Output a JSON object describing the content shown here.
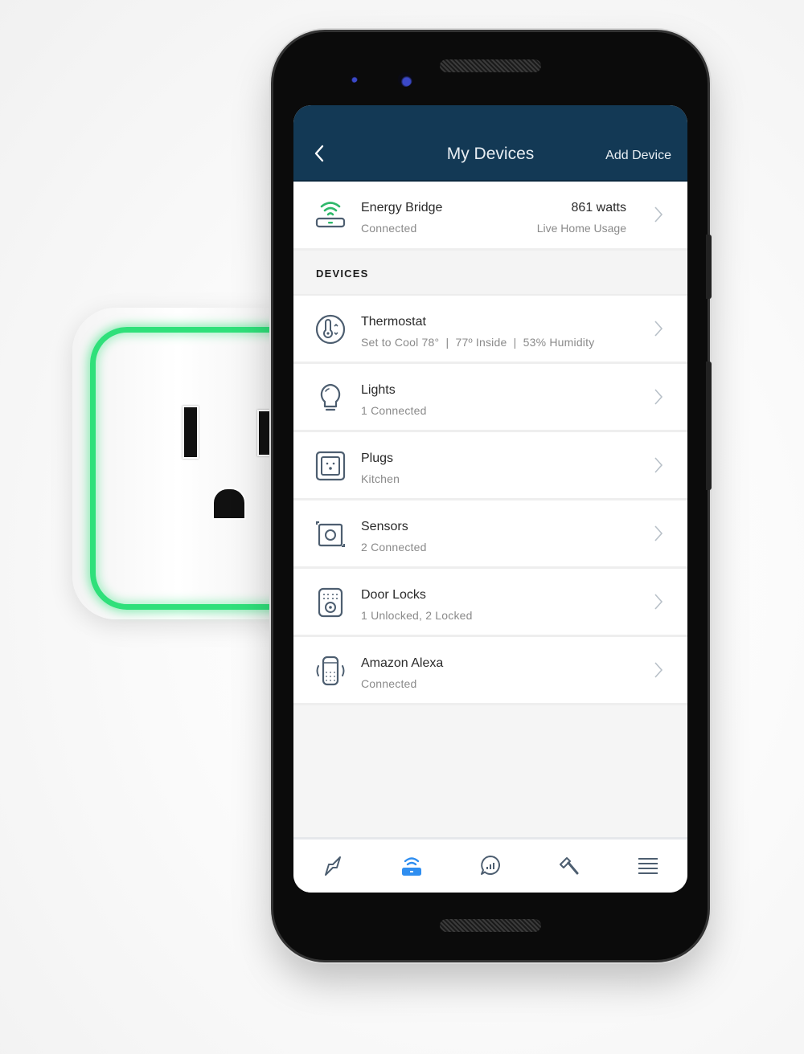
{
  "header": {
    "title": "My Devices",
    "back_icon": "chevron-left-icon",
    "add_label": "Add Device"
  },
  "energy_bridge": {
    "name": "Energy Bridge",
    "status": "Connected",
    "value": "861 watts",
    "value_label": "Live Home Usage",
    "icon": "energy-bridge-icon"
  },
  "section_label": "DEVICES",
  "devices": [
    {
      "name": "Thermostat",
      "status": "Set to Cool 78°  |  77º Inside  |  53% Humidity",
      "icon": "thermostat-icon"
    },
    {
      "name": "Lights",
      "status": "1 Connected",
      "icon": "lightbulb-icon"
    },
    {
      "name": "Plugs",
      "status": "Kitchen",
      "icon": "plug-icon"
    },
    {
      "name": "Sensors",
      "status": "2 Connected",
      "icon": "sensor-icon"
    },
    {
      "name": "Door Locks",
      "status": "1 Unlocked, 2 Locked",
      "icon": "door-lock-icon"
    },
    {
      "name": "Amazon Alexa",
      "status": "Connected",
      "icon": "alexa-icon"
    }
  ],
  "tabbar": {
    "active_index": 1,
    "tabs": [
      {
        "icon": "energy-icon"
      },
      {
        "icon": "devices-icon"
      },
      {
        "icon": "insights-chat-icon"
      },
      {
        "icon": "tools-hammer-icon"
      },
      {
        "icon": "menu-icon"
      }
    ]
  },
  "colors": {
    "header_bg": "#133955",
    "accent_green": "#2fb86b",
    "active_tab": "#2f8ef0",
    "icon_stroke": "#4d5e70",
    "plug_glow": "#2fe07a"
  }
}
